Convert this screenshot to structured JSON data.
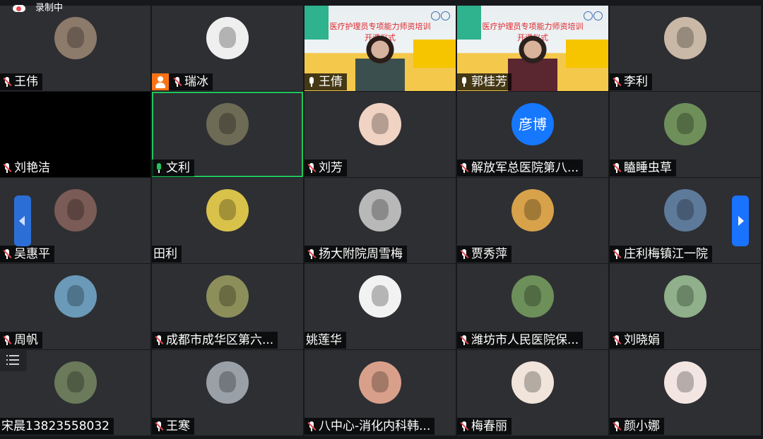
{
  "recording": {
    "text": "录制中",
    "icon": "cloud-record-icon"
  },
  "colors": {
    "selected_border": "#22c55e",
    "muted_slash": "#e5484d",
    "nav": "#1a73ff"
  },
  "participants": [
    {
      "name": "王伟",
      "mic": "muted",
      "kind": "avatar",
      "color": "#8c7a6b"
    },
    {
      "name": "瑞冰",
      "mic": "muted",
      "kind": "avatar",
      "color": "#efefef",
      "host_badge": true
    },
    {
      "name": "王倩",
      "mic": "on",
      "kind": "video",
      "banner": "医疗护理员专项能力师资培训\n开课仪式"
    },
    {
      "name": "郭桂芳",
      "mic": "on",
      "kind": "video",
      "banner": "医疗护理员专项能力师资培训\n开课仪式"
    },
    {
      "name": "李利",
      "mic": "muted",
      "kind": "avatar",
      "color": "#c9b8a6"
    },
    {
      "name": "刘艳洁",
      "mic": "muted",
      "kind": "black"
    },
    {
      "name": "文利",
      "mic": "active",
      "kind": "avatar",
      "color": "#6d6a55",
      "selected": true
    },
    {
      "name": "刘芳",
      "mic": "muted",
      "kind": "avatar",
      "color": "#f1d3c3"
    },
    {
      "name": "解放军总医院第八...",
      "mic": "muted",
      "kind": "text-avatar",
      "avatar_text": "彦博"
    },
    {
      "name": "瞌睡虫草",
      "mic": "muted",
      "kind": "avatar",
      "color": "#6f8f5a"
    },
    {
      "name": "吴惠平",
      "mic": "muted",
      "kind": "avatar",
      "color": "#7a5b56"
    },
    {
      "name": "田利",
      "mic": "none",
      "kind": "avatar",
      "color": "#d9c24a"
    },
    {
      "name": "扬大附院周雪梅",
      "mic": "muted",
      "kind": "avatar",
      "color": "#b8b8b8"
    },
    {
      "name": "贾秀萍",
      "mic": "muted",
      "kind": "avatar",
      "color": "#d7a24a"
    },
    {
      "name": "庄利梅镇江一院",
      "mic": "muted",
      "kind": "avatar",
      "color": "#5e7a9a"
    },
    {
      "name": "周帆",
      "mic": "muted",
      "kind": "avatar",
      "color": "#6a9ab8"
    },
    {
      "name": "成都市成华区第六...",
      "mic": "muted",
      "kind": "avatar",
      "color": "#8c8f5a"
    },
    {
      "name": "姚莲华",
      "mic": "none",
      "kind": "avatar",
      "color": "#f2f2f2"
    },
    {
      "name": "潍坊市人民医院保...",
      "mic": "muted",
      "kind": "avatar",
      "color": "#6d8f5a"
    },
    {
      "name": "刘晓娟",
      "mic": "muted",
      "kind": "avatar",
      "color": "#8fb08a"
    },
    {
      "name": "宋晨13823558032",
      "mic": "none",
      "kind": "avatar",
      "color": "#6a7a5a"
    },
    {
      "name": "王寒",
      "mic": "muted",
      "kind": "avatar",
      "color": "#9aa0a8"
    },
    {
      "name": "八中心-消化内科韩...",
      "mic": "muted",
      "kind": "avatar",
      "color": "#d8a08a"
    },
    {
      "name": "梅春丽",
      "mic": "muted",
      "kind": "avatar",
      "color": "#f1e4da"
    },
    {
      "name": "颜小娜",
      "mic": "muted",
      "kind": "avatar",
      "color": "#f3e6e2"
    }
  ]
}
